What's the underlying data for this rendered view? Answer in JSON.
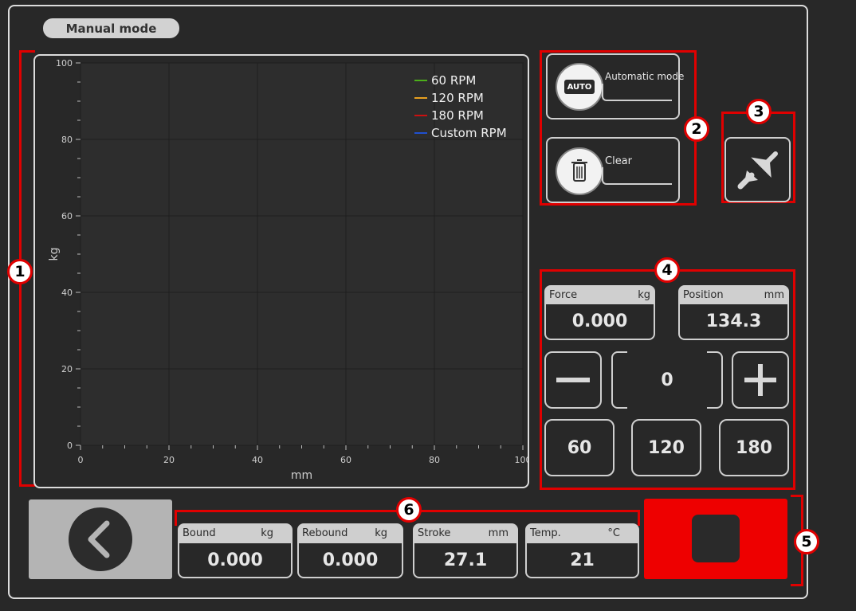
{
  "header": {
    "mode_label": "Manual mode"
  },
  "callouts": [
    "1",
    "2",
    "3",
    "4",
    "5",
    "6"
  ],
  "chart_data": {
    "type": "line",
    "xlabel": "mm",
    "ylabel": "kg",
    "xlim": [
      0,
      100
    ],
    "ylim": [
      0,
      100
    ],
    "x_ticks": [
      "0",
      "20",
      "40",
      "60",
      "80",
      "100"
    ],
    "y_ticks": [
      "0",
      "20",
      "40",
      "60",
      "80",
      "100"
    ],
    "grid": true,
    "legend_position": "top-right",
    "series": [
      {
        "name": "60 RPM",
        "color": "#4caf1a",
        "values": []
      },
      {
        "name": "120 RPM",
        "color": "#e8a020",
        "values": []
      },
      {
        "name": "180 RPM",
        "color": "#cc1010",
        "values": []
      },
      {
        "name": "Custom RPM",
        "color": "#2050d0",
        "values": []
      }
    ]
  },
  "actions": {
    "automatic_mode": {
      "label": "Automatic mode",
      "icon_text": "AUTO",
      "icon": "auto-icon"
    },
    "clear": {
      "label": "Clear",
      "icon": "trash-icon"
    },
    "collapse_icon": "collapse-arrows-icon"
  },
  "readouts": {
    "force": {
      "label": "Force",
      "unit": "kg",
      "value": "0.000"
    },
    "position": {
      "label": "Position",
      "unit": "mm",
      "value": "134.3"
    }
  },
  "stepper": {
    "value": "0",
    "minus_icon": "minus-icon",
    "plus_icon": "plus-icon"
  },
  "presets": [
    "60",
    "120",
    "180"
  ],
  "bottom": {
    "back_icon": "chevron-left-icon",
    "stop_icon": "stop-icon",
    "stats": [
      {
        "label": "Bound",
        "unit": "kg",
        "value": "0.000"
      },
      {
        "label": "Rebound",
        "unit": "kg",
        "value": "0.000"
      },
      {
        "label": "Stroke",
        "unit": "mm",
        "value": "27.1"
      },
      {
        "label": "Temp.",
        "unit": "°C",
        "value": "21"
      }
    ]
  },
  "colors": {
    "accent_red": "#e00000",
    "background": "#282828",
    "plot_bg": "#2d2d2d"
  }
}
